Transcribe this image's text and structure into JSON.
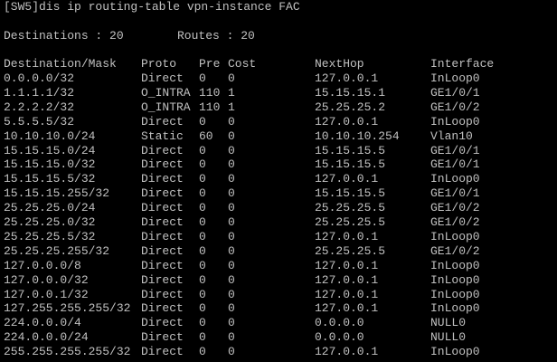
{
  "command_line": "[SW5]dis ip routing-table vpn-instance FAC",
  "summary": {
    "destinations": "Destinations : 20",
    "routes": "Routes : 20"
  },
  "table": {
    "headers": [
      "Destination/Mask",
      "Proto",
      "Pre",
      "Cost",
      "NextHop",
      "Interface"
    ],
    "rows": [
      [
        "0.0.0.0/32",
        "Direct",
        "0",
        "0",
        "127.0.0.1",
        "InLoop0"
      ],
      [
        "1.1.1.1/32",
        "O_INTRA",
        "110",
        "1",
        "15.15.15.1",
        "GE1/0/1"
      ],
      [
        "2.2.2.2/32",
        "O_INTRA",
        "110",
        "1",
        "25.25.25.2",
        "GE1/0/2"
      ],
      [
        "5.5.5.5/32",
        "Direct",
        "0",
        "0",
        "127.0.0.1",
        "InLoop0"
      ],
      [
        "10.10.10.0/24",
        "Static",
        "60",
        "0",
        "10.10.10.254",
        "Vlan10"
      ],
      [
        "15.15.15.0/24",
        "Direct",
        "0",
        "0",
        "15.15.15.5",
        "GE1/0/1"
      ],
      [
        "15.15.15.0/32",
        "Direct",
        "0",
        "0",
        "15.15.15.5",
        "GE1/0/1"
      ],
      [
        "15.15.15.5/32",
        "Direct",
        "0",
        "0",
        "127.0.0.1",
        "InLoop0"
      ],
      [
        "15.15.15.255/32",
        "Direct",
        "0",
        "0",
        "15.15.15.5",
        "GE1/0/1"
      ],
      [
        "25.25.25.0/24",
        "Direct",
        "0",
        "0",
        "25.25.25.5",
        "GE1/0/2"
      ],
      [
        "25.25.25.0/32",
        "Direct",
        "0",
        "0",
        "25.25.25.5",
        "GE1/0/2"
      ],
      [
        "25.25.25.5/32",
        "Direct",
        "0",
        "0",
        "127.0.0.1",
        "InLoop0"
      ],
      [
        "25.25.25.255/32",
        "Direct",
        "0",
        "0",
        "25.25.25.5",
        "GE1/0/2"
      ],
      [
        "127.0.0.0/8",
        "Direct",
        "0",
        "0",
        "127.0.0.1",
        "InLoop0"
      ],
      [
        "127.0.0.0/32",
        "Direct",
        "0",
        "0",
        "127.0.0.1",
        "InLoop0"
      ],
      [
        "127.0.0.1/32",
        "Direct",
        "0",
        "0",
        "127.0.0.1",
        "InLoop0"
      ],
      [
        "127.255.255.255/32",
        "Direct",
        "0",
        "0",
        "127.0.0.1",
        "InLoop0"
      ],
      [
        "224.0.0.0/4",
        "Direct",
        "0",
        "0",
        "0.0.0.0",
        "NULL0"
      ],
      [
        "224.0.0.0/24",
        "Direct",
        "0",
        "0",
        "0.0.0.0",
        "NULL0"
      ],
      [
        "255.255.255.255/32",
        "Direct",
        "0",
        "0",
        "127.0.0.1",
        "InLoop0"
      ]
    ]
  },
  "colors": {
    "background": "#000000",
    "text": "#c0c0c0"
  }
}
